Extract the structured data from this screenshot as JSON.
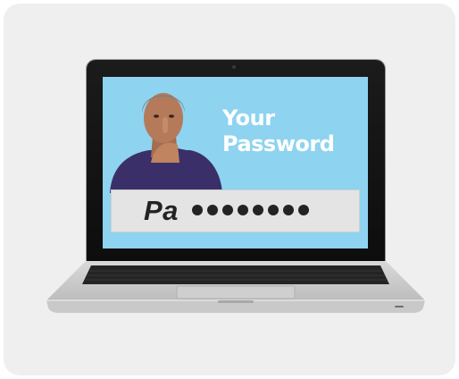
{
  "screen": {
    "headline_line1": "Your",
    "headline_line2": "Password",
    "password_visible": "Pa",
    "password_mask_count": 8
  },
  "colors": {
    "screen_background": "#8ed3f0",
    "headline": "#ffffff",
    "field_background": "#e4e4e4"
  }
}
